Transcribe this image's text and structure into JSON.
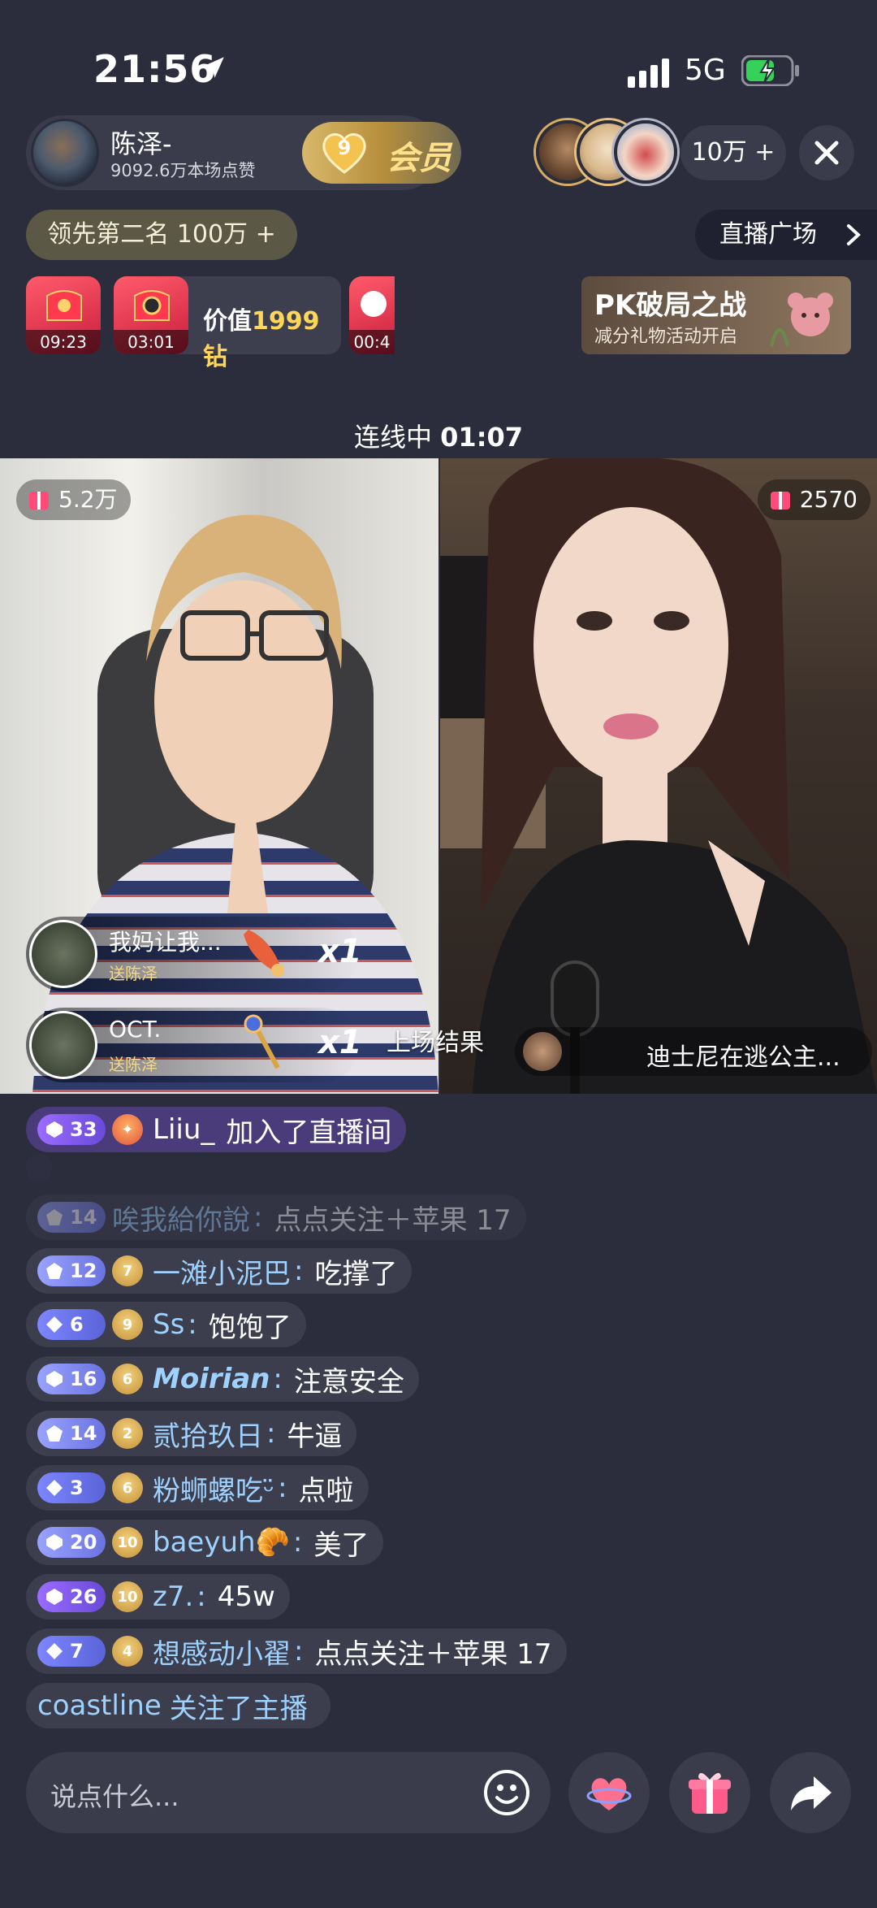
{
  "status": {
    "time": "21:56",
    "network": "5G",
    "battery_icon": "battery-charging-icon"
  },
  "host": {
    "name": "陈泽-",
    "likes": "9092.6万本场点赞",
    "member_level": "9",
    "member_label": "会员"
  },
  "viewers": {
    "count": "10万 +"
  },
  "rank": {
    "text": "领先第二名 100万 +"
  },
  "plaza": {
    "label": "直播广场"
  },
  "gift_timers": [
    {
      "time": "09:23"
    },
    {
      "time": "03:01",
      "value_prefix": "价值",
      "value_amount": "1999钻"
    },
    {
      "time": "00:4"
    }
  ],
  "pk_banner": {
    "title": "PK破局之战",
    "subtitle": "减分礼物活动开启"
  },
  "linking": {
    "label": "连线中",
    "time": "01:07"
  },
  "left_stream": {
    "popularity": "5.2万",
    "gifts": [
      {
        "sender": "我妈让我...",
        "target": "送陈泽",
        "count": "x1"
      },
      {
        "sender": "OCT.",
        "target": "送陈泽",
        "count": "x1"
      }
    ]
  },
  "finish_label": "上场结果",
  "right_stream": {
    "popularity": "2570",
    "user_name": "迪士尼在逃公主..."
  },
  "chat": {
    "join": {
      "level": "33",
      "name": "Liiu_",
      "text": "加入了直播间"
    },
    "messages": [
      {
        "level": "14",
        "fan": "",
        "name": "唉我給你說",
        "text": "点点关注＋苹果 17"
      },
      {
        "level": "12",
        "fan": "7",
        "name": "一滩小泥巴",
        "text": "吃撑了"
      },
      {
        "level": "6",
        "fan": "9",
        "name": "Ss",
        "text": "饱饱了"
      },
      {
        "level": "16",
        "fan": "6",
        "name": "Moirian",
        "text": "注意安全"
      },
      {
        "level": "14",
        "fan": "2",
        "name": "贰拾玖日",
        "text": "牛逼"
      },
      {
        "level": "3",
        "fan": "6",
        "name": "粉蛳螺吃ᵕ̈",
        "text": "点啦"
      },
      {
        "level": "20",
        "fan": "10",
        "name": "baeyuh🥐",
        "text": "美了"
      },
      {
        "level": "26",
        "fan": "10",
        "name": "z7.",
        "text": "45w"
      },
      {
        "level": "7",
        "fan": "4",
        "name": "想感动小翟",
        "text": "点点关注＋苹果 17"
      }
    ],
    "follow": {
      "name": "coastline",
      "text": "关注了主播"
    }
  },
  "input": {
    "placeholder": "说点什么..."
  },
  "colors": {
    "background": "#2b2d3c",
    "pill": "#3a3c4b",
    "accent_gold": "#ffd65a",
    "name_blue": "#9fd1ff"
  }
}
